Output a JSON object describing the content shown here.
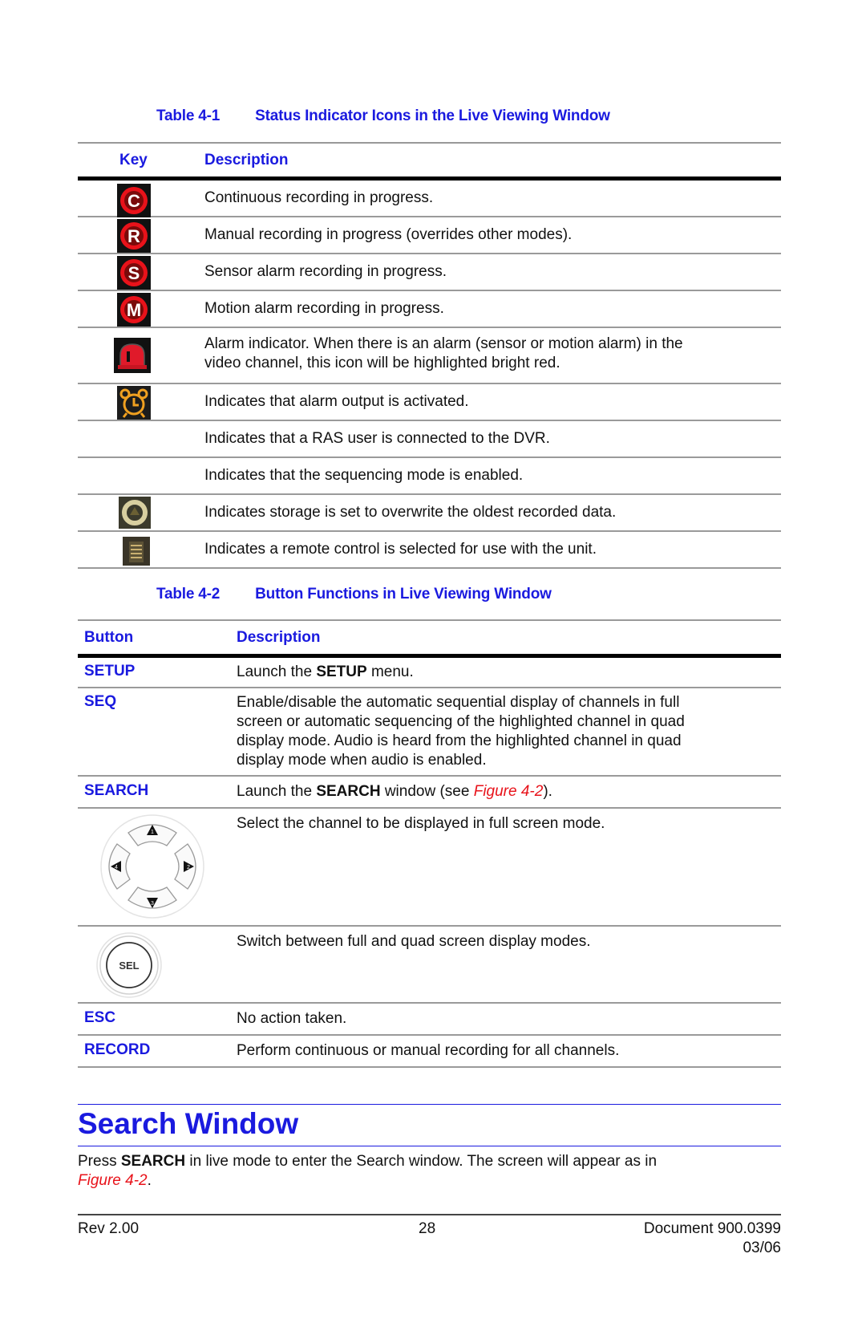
{
  "table1": {
    "caption_num": "Table 4-1",
    "caption_title": "Status Indicator Icons in the Live Viewing Window",
    "headers": {
      "key": "Key",
      "description": "Description"
    },
    "rows": [
      {
        "icon": "continuous-recording-icon",
        "glyph": "C",
        "description": "Continuous recording in progress."
      },
      {
        "icon": "manual-recording-icon",
        "glyph": "R",
        "description": "Manual recording in progress (overrides other modes)."
      },
      {
        "icon": "sensor-alarm-recording-icon",
        "glyph": "S",
        "description": "Sensor alarm recording in progress."
      },
      {
        "icon": "motion-alarm-recording-icon",
        "glyph": "M",
        "description": "Motion alarm recording in progress."
      },
      {
        "icon": "alarm-indicator-icon",
        "glyph": "",
        "description_line1": "Alarm indicator. When there is an alarm (sensor or motion alarm) in the",
        "description_line2": "video channel, this icon will be highlighted bright red."
      },
      {
        "icon": "alarm-clock-icon",
        "glyph": "",
        "description": "Indicates that alarm output is activated."
      },
      {
        "icon": "",
        "glyph": "",
        "description": "Indicates that a RAS user is connected to the DVR."
      },
      {
        "icon": "",
        "glyph": "",
        "description": "Indicates that the sequencing mode is enabled."
      },
      {
        "icon": "recycle-overwrite-icon",
        "glyph": "",
        "description": "Indicates storage is set to overwrite the oldest recorded data."
      },
      {
        "icon": "remote-control-icon",
        "glyph": "",
        "description": "Indicates a remote control is selected for use with the unit."
      }
    ]
  },
  "table2": {
    "caption_num": "Table 4-2",
    "caption_title": "Button Functions in Live Viewing Window",
    "headers": {
      "button": "Button",
      "description": "Description"
    },
    "rows": {
      "setup": {
        "key": "SETUP",
        "pre": "Launch the ",
        "bold": "SETUP",
        "post": " menu."
      },
      "seq": {
        "key": "SEQ",
        "lines": [
          "Enable/disable the automatic sequential display of channels in full",
          "screen or automatic sequencing of the highlighted channel in quad",
          "display mode. Audio is heard from the highlighted channel in quad",
          "display mode when audio is enabled."
        ]
      },
      "search": {
        "key": "SEARCH",
        "pre": "Launch the ",
        "bold": "SEARCH",
        "mid": " window (see ",
        "link": "Figure 4-2",
        "post": ")."
      },
      "arrows": {
        "labels": [
          "1",
          "2",
          "3",
          "4"
        ],
        "description": "Select the channel to be displayed in full screen mode."
      },
      "sel": {
        "label": "SEL",
        "description": "Switch between full and quad screen display modes."
      },
      "esc": {
        "key": "ESC",
        "description": "No action taken."
      },
      "record": {
        "key": "RECORD",
        "description": "Perform continuous or manual recording for all channels."
      }
    }
  },
  "section": {
    "title": "Search Window",
    "para_pre": "Press ",
    "para_bold": "SEARCH",
    "para_post": " in live mode to enter the Search window. The screen will appear as in",
    "para_link": "Figure 4-2",
    "para_end": "."
  },
  "footer": {
    "rev": "Rev 2.00",
    "page": "28",
    "document": "Document 900.0399",
    "date": "03/06"
  },
  "colors": {
    "heading_blue": "#1a1adf",
    "link_red": "#e8121a"
  }
}
